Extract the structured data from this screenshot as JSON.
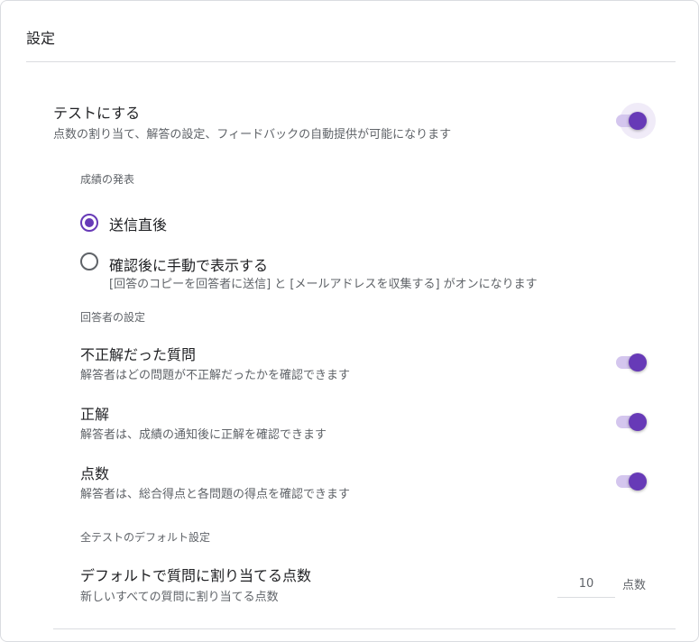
{
  "card": {
    "title": "設定"
  },
  "quiz": {
    "title": "テストにする",
    "description": "点数の割り当て、解答の設定、フィードバックの自動提供が可能になります",
    "enabled": true
  },
  "release_grade": {
    "heading": "成績の発表",
    "options": [
      {
        "label": "送信直後",
        "checked": true
      },
      {
        "label": "確認後に手動で表示する",
        "note": "[回答のコピーを回答者に送信] と [メールアドレスを収集する] がオンになります",
        "checked": false
      }
    ]
  },
  "respondent": {
    "heading": "回答者の設定",
    "items": [
      {
        "title": "不正解だった質問",
        "description": "解答者はどの問題が不正解だったかを確認できます",
        "enabled": true
      },
      {
        "title": "正解",
        "description": "解答者は、成績の通知後に正解を確認できます",
        "enabled": true
      },
      {
        "title": "点数",
        "description": "解答者は、総合得点と各問題の得点を確認できます",
        "enabled": true
      }
    ]
  },
  "defaults": {
    "heading": "全テストのデフォルト設定",
    "title": "デフォルトで質問に割り当てる点数",
    "description": "新しいすべての質問に割り当てる点数",
    "points_value": "10",
    "points_unit": "点数"
  },
  "colors": {
    "accent": "#673ab7",
    "track": "#d4c6ee",
    "divider": "#dadce0"
  }
}
